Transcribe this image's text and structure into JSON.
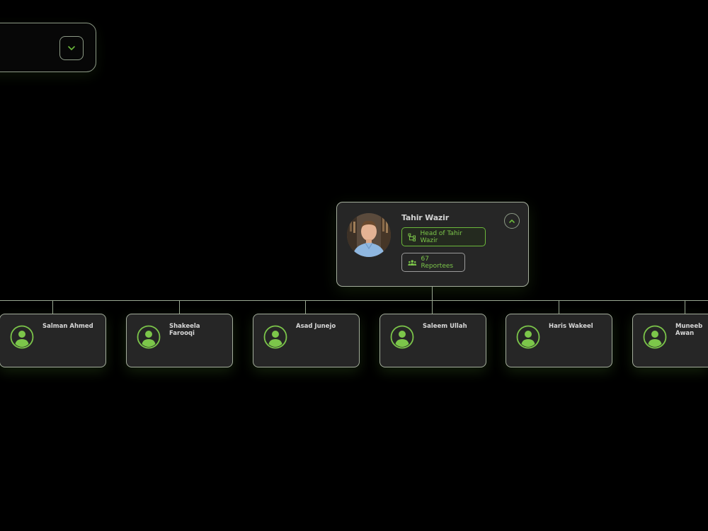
{
  "colors": {
    "accent": "#7cc64a",
    "card_bg": "#262626",
    "border": "#a4ad9c",
    "connector": "#9aa893",
    "page_bg": "#000000"
  },
  "top_card": {
    "toggle_icon": "chevron-down-icon"
  },
  "head": {
    "name": "Tahir Wazir",
    "avatar_icon": "profile-photo",
    "title_icon": "org-chart-icon",
    "title": "Head of Tahir Wazir",
    "reportees_icon": "users-icon",
    "reportees": "67 Reportees",
    "collapse_icon": "chevron-up-icon"
  },
  "children": [
    {
      "name": "Salman Ahmed",
      "avatar_icon": "user-avatar-icon"
    },
    {
      "name": "Shakeela Farooqi",
      "avatar_icon": "user-avatar-icon"
    },
    {
      "name": "Asad Junejo",
      "avatar_icon": "user-avatar-icon"
    },
    {
      "name": "Saleem Ullah",
      "avatar_icon": "user-avatar-icon"
    },
    {
      "name": "Haris Wakeel",
      "avatar_icon": "user-avatar-icon"
    },
    {
      "name": "Muneeb Awan",
      "avatar_icon": "user-avatar-icon"
    }
  ]
}
